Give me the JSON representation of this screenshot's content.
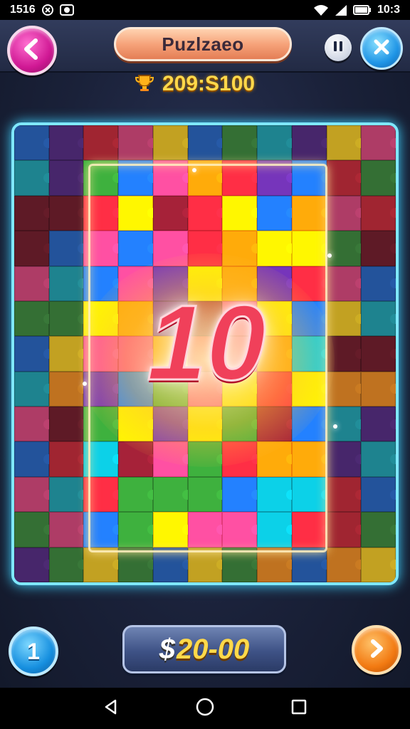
{
  "status_bar": {
    "time_left": "1516",
    "time_right": "10:3",
    "icons": [
      "sync-icon",
      "camera-icon",
      "wifi-icon",
      "signal-icon",
      "battery-icon"
    ]
  },
  "header": {
    "title": "Puzlzaeo",
    "score": "209:S100",
    "icons": [
      "back-icon",
      "pause-icon",
      "close-icon",
      "trophy-icon"
    ]
  },
  "board": {
    "level_number": "10",
    "colors": [
      "#3a8a3a",
      "#d02a3a",
      "#e0457f",
      "#f2c418",
      "#2566c8",
      "#5a2d8a",
      "#f28a1a",
      "#1aa3b3",
      "#7a1e2e"
    ]
  },
  "controls": {
    "hint_label": "1",
    "coins_symbol": "$",
    "coins_value": "20-00",
    "icons": [
      "next-icon"
    ]
  },
  "nav_bar": {
    "icons": [
      "nav-back-icon",
      "nav-home-icon",
      "nav-recents-icon"
    ]
  }
}
